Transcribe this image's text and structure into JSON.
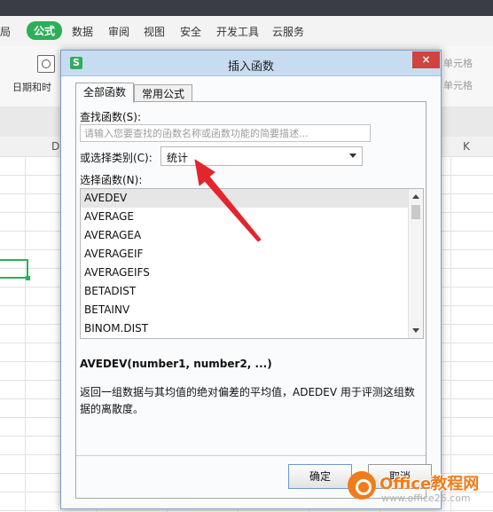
{
  "ribbon_tabs": [
    {
      "label": "局",
      "active": false
    },
    {
      "label": "公式",
      "active": true
    },
    {
      "label": "数据",
      "active": false
    },
    {
      "label": "审阅",
      "active": false
    },
    {
      "label": "视图",
      "active": false
    },
    {
      "label": "安全",
      "active": false
    },
    {
      "label": "开发工具",
      "active": false
    },
    {
      "label": "云服务",
      "active": false
    }
  ],
  "ribbon": {
    "datetime_label": "日期和时",
    "right_text_1": "单元格",
    "right_text_2": "单元格"
  },
  "columns": {
    "left": "D",
    "right": "K"
  },
  "dialog": {
    "title": "插入函数",
    "close_glyph": "×",
    "tabs": [
      "全部函数",
      "常用公式"
    ],
    "search_label": "查找函数(S):",
    "search_placeholder": "请输入您要查找的函数名称或函数功能的简要描述...",
    "category_label": "或选择类别(C):",
    "category_value": "统计",
    "function_list_label": "选择函数(N):",
    "functions": [
      "AVEDEV",
      "AVERAGE",
      "AVERAGEA",
      "AVERAGEIF",
      "AVERAGEIFS",
      "BETADIST",
      "BETAINV",
      "BINOM.DIST"
    ],
    "selected_function": "AVEDEV",
    "signature": "AVEDEV(number1, number2, ...)",
    "description": "返回一组数据与其均值的绝对偏差的平均值，ADEDEV 用于评测这组数据的离散度。",
    "ok_label": "确定",
    "cancel_label": "取消"
  },
  "watermark": {
    "text": "Office教程网",
    "sub": "www.office26.com"
  },
  "colors": {
    "accent_green": "#2fae5a",
    "arrow_red": "#e3252c",
    "watermark_orange": "#f07d1b"
  }
}
